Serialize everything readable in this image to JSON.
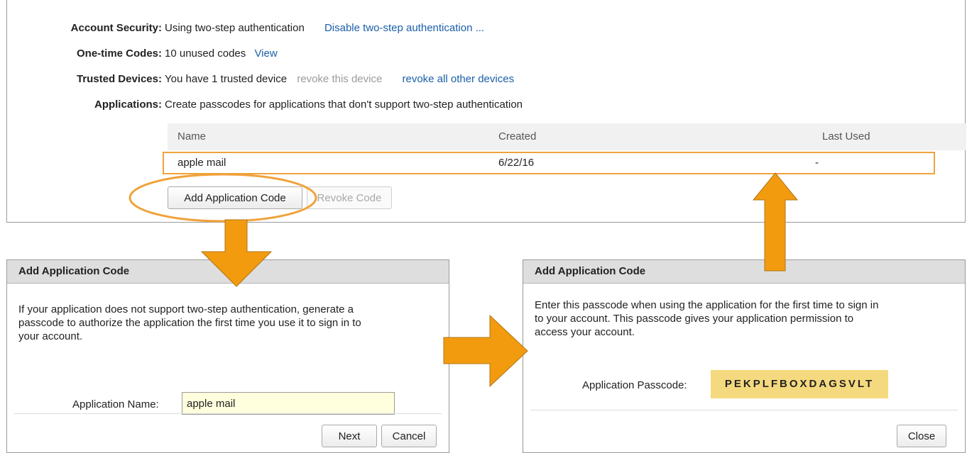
{
  "security": {
    "account_label": "Account Security:",
    "account_value": "Using two-step authentication",
    "account_link": "Disable two-step authentication ...",
    "codes_label": "One-time Codes:",
    "codes_value": "10 unused codes",
    "codes_link": "View",
    "devices_label": "Trusted Devices:",
    "devices_value": "You have 1 trusted device",
    "devices_revoke_this": "revoke this device",
    "devices_revoke_all": "revoke all other devices",
    "apps_label": "Applications:",
    "apps_value": "Create passcodes for applications that don't support two-step authentication"
  },
  "table": {
    "columns": [
      "Name",
      "Created",
      "Last Used"
    ],
    "rows": [
      {
        "name": "apple mail",
        "created": "6/22/16",
        "last_used": "-"
      }
    ]
  },
  "buttons": {
    "add_code": "Add Application Code",
    "revoke_code": "Revoke Code"
  },
  "dialog_left": {
    "title": "Add Application Code",
    "body_lines": [
      "If your application does not support two-step authentication, generate a",
      "passcode to authorize the application the first time you use it to sign in to",
      "your account."
    ],
    "field_label": "Application Name:",
    "field_value": "apple mail",
    "next": "Next",
    "cancel": "Cancel"
  },
  "dialog_right": {
    "title": "Add Application Code",
    "body_lines": [
      "Enter this passcode when using the application for the first time to sign in",
      "to your account. This passcode gives your application permission to",
      "access your account."
    ],
    "passcode_label": "Application Passcode:",
    "passcode_value": "PEKPLFBOXDAGSVLT",
    "close": "Close"
  },
  "colors": {
    "link": "#1a5fa8",
    "highlight": "#f0a23a",
    "passcode_bg": "#f5d97e",
    "input_bg": "#ffffdd"
  },
  "icons": [
    "down-arrow-icon",
    "right-arrow-icon",
    "up-arrow-icon",
    "highlight-ellipse"
  ]
}
